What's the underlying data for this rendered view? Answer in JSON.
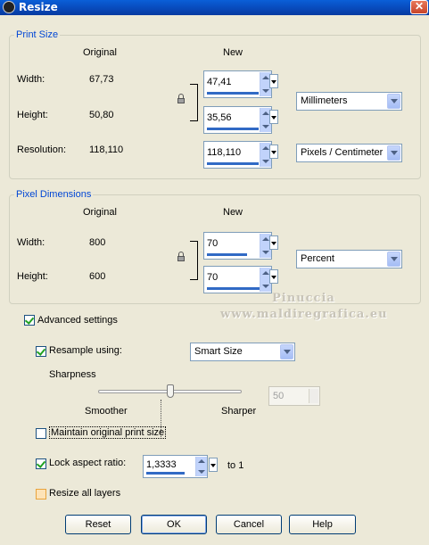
{
  "window": {
    "title": "Resize",
    "close_icon": "close-icon"
  },
  "print_size": {
    "legend": "Print Size",
    "col_original": "Original",
    "col_new": "New",
    "width_label": "Width:",
    "width_original": "67,73",
    "width_new": "47,41",
    "height_label": "Height:",
    "height_original": "50,80",
    "height_new": "35,56",
    "resolution_label": "Resolution:",
    "resolution_original": "118,110",
    "resolution_new": "118,110",
    "unit": "Millimeters",
    "resolution_unit": "Pixels / Centimeter"
  },
  "pixel_dimensions": {
    "legend": "Pixel Dimensions",
    "col_original": "Original",
    "col_new": "New",
    "width_label": "Width:",
    "width_original": "800",
    "width_new": "70",
    "height_label": "Height:",
    "height_original": "600",
    "height_new": "70",
    "unit": "Percent"
  },
  "watermark": {
    "line1": "Pinuccia",
    "line2": "www.maldiregrafica.eu"
  },
  "advanced": {
    "advanced_settings_label": "Advanced settings",
    "advanced_settings_checked": true,
    "resample_label": "Resample using:",
    "resample_checked": true,
    "resample_method": "Smart Size",
    "sharpness_label": "Sharpness",
    "smoother_label": "Smoother",
    "sharper_label": "Sharper",
    "sharpness_value": "50",
    "sharpness_level": 0.5,
    "maintain_label": "Maintain original print size",
    "maintain_checked": false,
    "lock_label": "Lock aspect ratio:",
    "lock_checked": true,
    "aspect_ratio": "1,3333",
    "to_one": "to 1",
    "resize_layers_label": "Resize all layers",
    "resize_layers_checked": false
  },
  "buttons": {
    "reset": "Reset",
    "ok": "OK",
    "cancel": "Cancel",
    "help": "Help"
  },
  "colors": {
    "title_bar": "#0848b8",
    "legend_text": "#0046d5",
    "accent": "#316ac5"
  }
}
